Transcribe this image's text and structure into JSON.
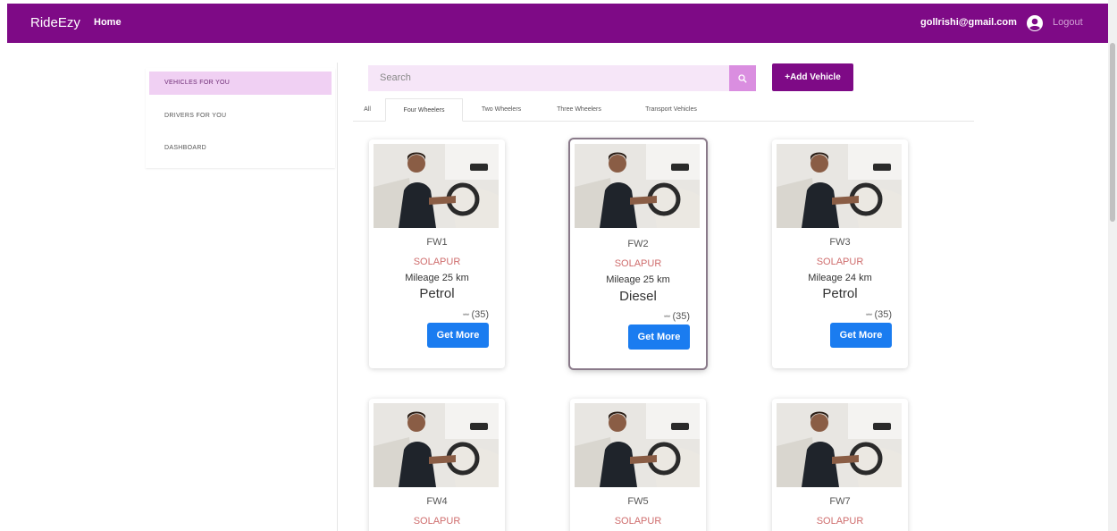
{
  "nav": {
    "brand": "RideEzy",
    "home": "Home",
    "email": "gollrishi@gmail.com",
    "logout": "Logout"
  },
  "sidebar": {
    "items": [
      {
        "label": "VEHICLES FOR YOU",
        "active": true
      },
      {
        "label": "DRIVERS FOR YOU",
        "active": false
      },
      {
        "label": "DASHBOARD",
        "active": false
      }
    ]
  },
  "search": {
    "placeholder": "Search"
  },
  "add_vehicle_label": "+Add Vehicle",
  "tabs": [
    {
      "label": "All",
      "active": false
    },
    {
      "label": "Four Wheelers",
      "active": true
    },
    {
      "label": "Two Wheelers",
      "active": false
    },
    {
      "label": "Three Wheelers",
      "active": false
    },
    {
      "label": "Transport Vehicles",
      "active": false
    }
  ],
  "vehicles": [
    {
      "name": "FW1",
      "city": "SOLAPUR",
      "mileage": "Mileage 25 km",
      "fuel": "Petrol",
      "stars": "*****",
      "reviews": "(35)",
      "button": "Get More"
    },
    {
      "name": "FW2",
      "city": "SOLAPUR",
      "mileage": "Mileage 25 km",
      "fuel": "Diesel",
      "stars": "*****",
      "reviews": "(35)",
      "button": "Get More"
    },
    {
      "name": "FW3",
      "city": "SOLAPUR",
      "mileage": "Mileage 24 km",
      "fuel": "Petrol",
      "stars": "*****",
      "reviews": "(35)",
      "button": "Get More"
    },
    {
      "name": "FW4",
      "city": "SOLAPUR"
    },
    {
      "name": "FW5",
      "city": "SOLAPUR"
    },
    {
      "name": "FW7",
      "city": "SOLAPUR"
    }
  ],
  "colors": {
    "brand": "#7e0a86",
    "button": "#1a7cf0",
    "city": "#cf6d6d",
    "sidebar_active": "#f0d0f3"
  },
  "icons": {
    "search": "search-icon",
    "user": "user-circle-icon"
  }
}
